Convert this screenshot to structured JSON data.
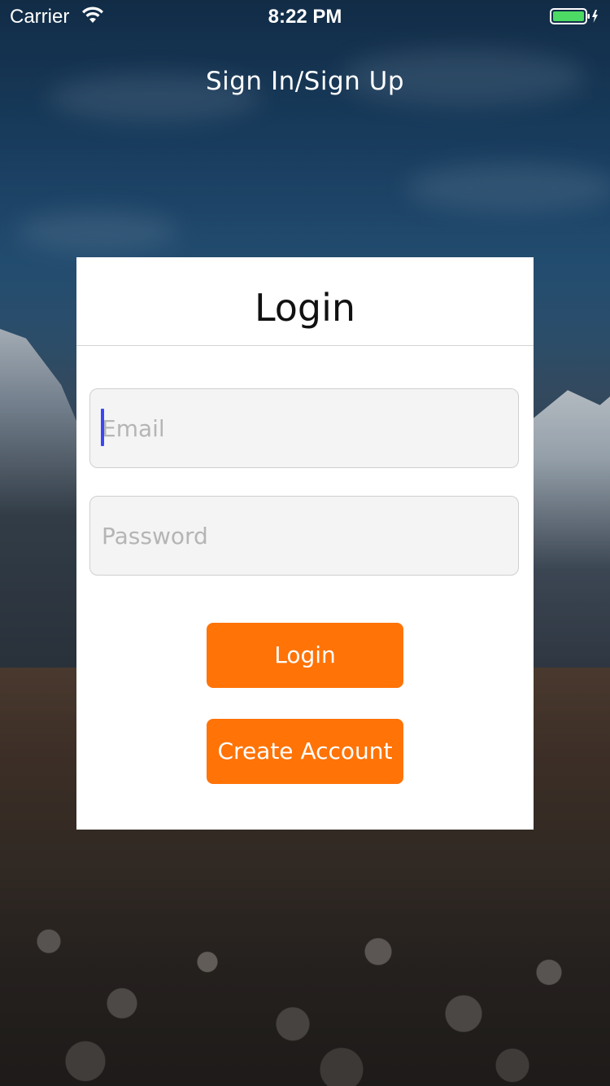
{
  "status_bar": {
    "carrier": "Carrier",
    "time": "8:22 PM",
    "wifi_icon": "wifi-icon",
    "battery_icon": "battery-charging-icon",
    "battery_color": "#4cd964"
  },
  "nav": {
    "title": "Sign In/Sign Up"
  },
  "card": {
    "title": "Login",
    "email": {
      "placeholder": "Email",
      "value": ""
    },
    "password": {
      "placeholder": "Password",
      "value": ""
    },
    "login_label": "Login",
    "create_account_label": "Create Account"
  },
  "colors": {
    "accent": "#ff7307",
    "caret": "#3b46f5"
  }
}
